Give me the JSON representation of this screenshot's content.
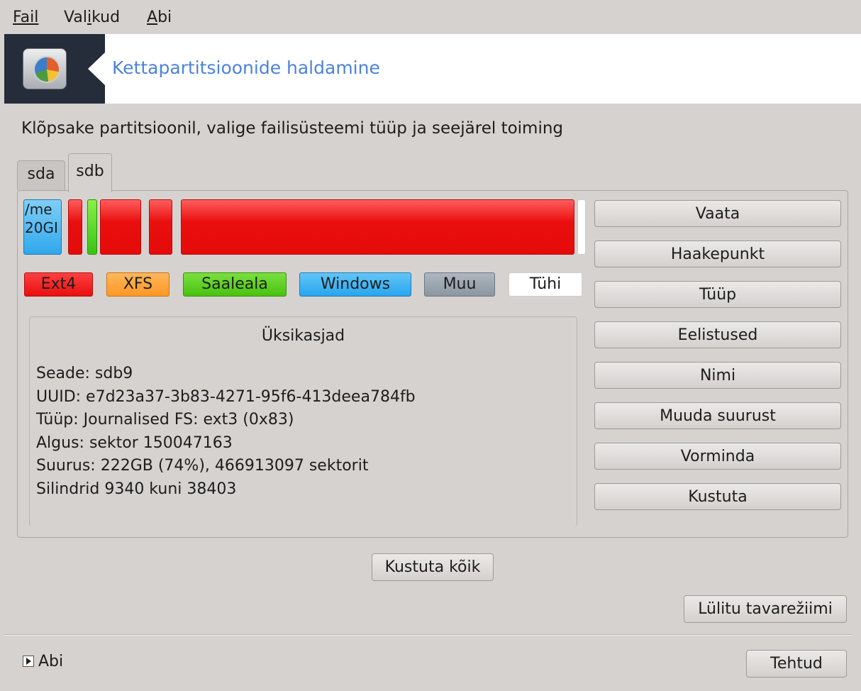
{
  "menubar": {
    "items": [
      {
        "label": "Fail",
        "mnemonic_index": 0
      },
      {
        "label": "Valikud",
        "mnemonic_index": 3
      },
      {
        "label": "Abi",
        "mnemonic_index": 0
      }
    ]
  },
  "banner": {
    "title": "Kettapartitsioonide haldamine",
    "icon": "harddisk-pie-icon"
  },
  "instruction": "Klõpsake partitsioonil, valige failisüsteemi tüüp ja seejärel toiming",
  "tabs": [
    {
      "label": "sda",
      "selected": false
    },
    {
      "label": "sdb",
      "selected": true
    }
  ],
  "partitions": [
    {
      "type": "Windows",
      "label_line1": "/me",
      "label_line2": "20GI"
    },
    {
      "type": "Ext4"
    },
    {
      "type": "Saaleala"
    },
    {
      "type": "Ext4"
    },
    {
      "type": "Ext4"
    },
    {
      "type": "Ext4",
      "selected": true
    },
    {
      "type": "Tühi"
    }
  ],
  "legend": [
    {
      "label": "Ext4",
      "color": "#ee1e1e"
    },
    {
      "label": "XFS",
      "color": "#ffa23a"
    },
    {
      "label": "Saaleala",
      "color": "#5ad022"
    },
    {
      "label": "Windows",
      "color": "#3bb3f2"
    },
    {
      "label": "Muu",
      "color": "#99a4ae"
    },
    {
      "label": "Tühi",
      "color": "#ffffff"
    }
  ],
  "details": {
    "title": "Üksikasjad",
    "lines": [
      "Seade: sdb9",
      "UUID: e7d23a37-3b83-4271-95f6-413deea784fb",
      "Tüüp: Journalised FS: ext3 (0x83)",
      "Algus: sektor 150047163",
      "Suurus: 222GB (74%), 466913097 sektorit",
      "Silindrid 9340 kuni 38403"
    ]
  },
  "actions": [
    "Vaata",
    "Haakepunkt",
    "Tüüp",
    "Eelistused",
    "Nimi",
    "Muuda suurust",
    "Vorminda",
    "Kustuta"
  ],
  "buttons": {
    "delete_all": "Kustuta kõik",
    "toggle_mode": "Lülitu tavarežiimi",
    "done": "Tehtud"
  },
  "help": {
    "label": "Abi",
    "icon": "expand-arrow-icon"
  }
}
